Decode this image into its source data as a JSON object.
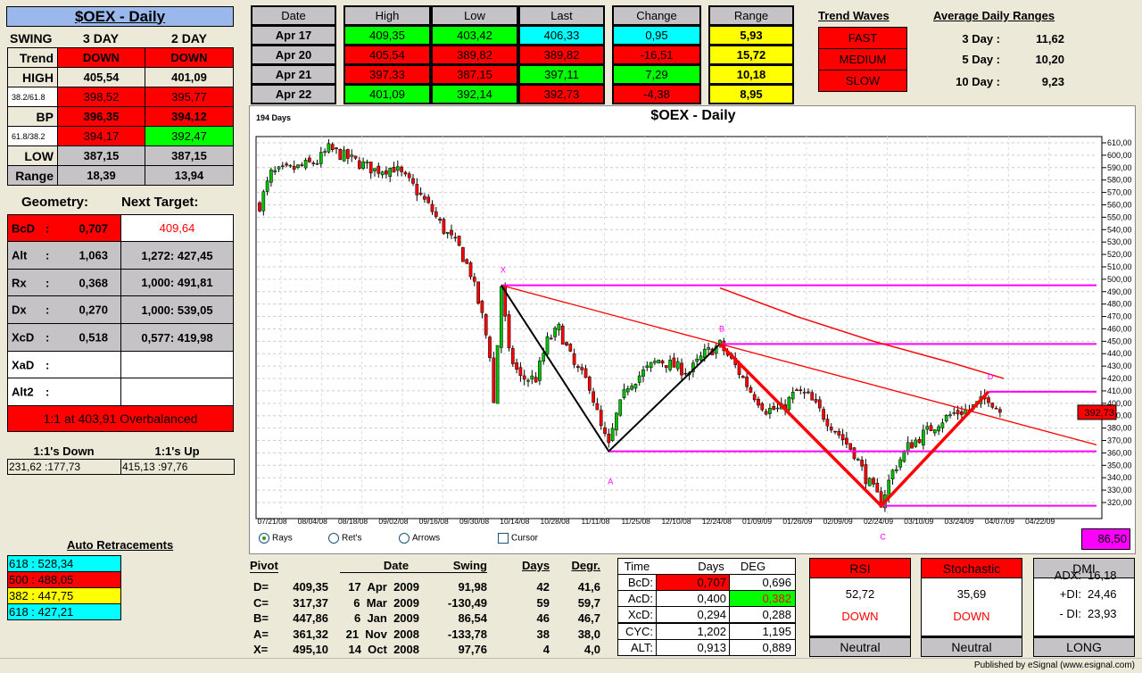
{
  "left": {
    "title": "$OEX - Daily",
    "swing_label": "SWING",
    "col3": "3 DAY",
    "col2": "2 DAY",
    "rows": [
      {
        "label": "Trend",
        "v3": "DOWN",
        "v2": "DOWN"
      },
      {
        "label": "HIGH",
        "v3": "405,54",
        "v2": "401,09"
      },
      {
        "label": "38.2/61.8",
        "v3": "398,52",
        "v2": "395,77"
      },
      {
        "label": "BP",
        "v3": "396,35",
        "v2": "394,12"
      },
      {
        "label": "61.8/38.2",
        "v3": "394,17",
        "v2": "392,47"
      },
      {
        "label": "LOW",
        "v3": "387,15",
        "v2": "387,15"
      },
      {
        "label": "Range",
        "v3": "18,39",
        "v2": "13,94"
      }
    ],
    "geometry_label": "Geometry:",
    "next_target_label": "Next Target:",
    "geometry": [
      {
        "name": "BcD",
        "val": "0,707",
        "target": "409,64"
      },
      {
        "name": "Alt",
        "val": "1,063",
        "target": "1,272: 427,45"
      },
      {
        "name": "Rx",
        "val": "0,368",
        "target": "1,000: 491,81"
      },
      {
        "name": "Dx",
        "val": "0,270",
        "target": "1,000: 539,05"
      },
      {
        "name": "XcD",
        "val": "0,518",
        "target": "0,577: 419,98"
      },
      {
        "name": "XaD",
        "val": "",
        "target": ""
      },
      {
        "name": "Alt2",
        "val": "",
        "target": ""
      }
    ],
    "colon": ":",
    "overbalanced": "1:1 at 403,91 Overbalanced",
    "down_label": "1:1's Down",
    "up_label": "1:1's Up",
    "down_value": "231,62 :177,73",
    "up_value": "415,13 :97,76",
    "auto_ret_label": "Auto Retracements",
    "auto_ret": [
      "618 : 528,34",
      "500 : 488,05",
      "382 : 447,75",
      "618 : 427,21"
    ]
  },
  "top": {
    "headers": {
      "date": "Date",
      "high": "High",
      "low": "Low",
      "last": "Last",
      "change": "Change",
      "range": "Range"
    },
    "rows": [
      {
        "date": "Apr  17",
        "high": "409,35",
        "low": "403,42",
        "last": "406,33",
        "change": "0,95",
        "range": "5,93"
      },
      {
        "date": "Apr  20",
        "high": "405,54",
        "low": "389,82",
        "last": "389,82",
        "change": "-16,51",
        "range": "15,72"
      },
      {
        "date": "Apr  21",
        "high": "397,33",
        "low": "387,15",
        "last": "397,11",
        "change": "7,29",
        "range": "10,18"
      },
      {
        "date": "Apr  22",
        "high": "401,09",
        "low": "392,14",
        "last": "392,73",
        "change": "-4,38",
        "range": "8,95"
      }
    ],
    "trend_waves_label": "Trend Waves",
    "trend_waves": [
      "FAST",
      "MEDIUM",
      "SLOW"
    ],
    "adr_label": "Average Daily Ranges",
    "adr": [
      {
        "label": "3 Day :",
        "val": "11,62"
      },
      {
        "label": "5 Day :",
        "val": "10,20"
      },
      {
        "label": "10 Day :",
        "val": "9,23"
      }
    ]
  },
  "chart": {
    "days_label": "194 Days",
    "title": "$OEX - Daily",
    "last_price": "392,73",
    "magenta_value": "86,50",
    "options": {
      "rays": "Rays",
      "rets": "Ret's",
      "arrows": "Arrows",
      "cursor": "Cursor"
    }
  },
  "chart_data": {
    "type": "candlestick",
    "title": "$OEX - Daily",
    "ylim": [
      320,
      610
    ],
    "y_ticks": [
      "610,00",
      "600,00",
      "590,00",
      "580,00",
      "570,00",
      "560,00",
      "550,00",
      "540,00",
      "530,00",
      "520,00",
      "510,00",
      "500,00",
      "490,00",
      "480,00",
      "470,00",
      "460,00",
      "450,00",
      "440,00",
      "430,00",
      "420,00",
      "410,00",
      "400,00",
      "390,00",
      "380,00",
      "370,00",
      "360,00",
      "350,00",
      "340,00",
      "330,00",
      "320,00"
    ],
    "x_ticks": [
      "07/21/08",
      "08/04/08",
      "08/18/08",
      "09/02/08",
      "09/16/08",
      "09/30/08",
      "10/14/08",
      "10/28/08",
      "11/11/08",
      "11/25/08",
      "12/10/08",
      "12/24/08",
      "01/09/09",
      "01/26/09",
      "02/09/09",
      "02/24/09",
      "03/10/09",
      "03/24/09",
      "04/07/09",
      "04/22/09"
    ],
    "num_bars": 194,
    "close_anchors": [
      [
        0,
        560
      ],
      [
        3,
        585
      ],
      [
        10,
        590
      ],
      [
        15,
        595
      ],
      [
        18,
        605
      ],
      [
        25,
        595
      ],
      [
        30,
        588
      ],
      [
        35,
        590
      ],
      [
        40,
        575
      ],
      [
        45,
        555
      ],
      [
        48,
        540
      ],
      [
        52,
        525
      ],
      [
        55,
        505
      ],
      [
        58,
        470
      ],
      [
        60,
        440
      ],
      [
        61,
        400
      ],
      [
        63,
        495
      ],
      [
        65,
        440
      ],
      [
        68,
        420
      ],
      [
        72,
        420
      ],
      [
        75,
        450
      ],
      [
        78,
        460
      ],
      [
        82,
        430
      ],
      [
        86,
        415
      ],
      [
        89,
        380
      ],
      [
        91,
        365
      ],
      [
        93,
        390
      ],
      [
        96,
        415
      ],
      [
        100,
        425
      ],
      [
        104,
        435
      ],
      [
        108,
        430
      ],
      [
        112,
        425
      ],
      [
        116,
        440
      ],
      [
        120,
        447
      ],
      [
        124,
        430
      ],
      [
        128,
        410
      ],
      [
        132,
        395
      ],
      [
        136,
        395
      ],
      [
        140,
        410
      ],
      [
        143,
        405
      ],
      [
        147,
        390
      ],
      [
        151,
        375
      ],
      [
        155,
        360
      ],
      [
        158,
        340
      ],
      [
        162,
        320
      ],
      [
        165,
        345
      ],
      [
        169,
        365
      ],
      [
        173,
        375
      ],
      [
        177,
        385
      ],
      [
        181,
        392
      ],
      [
        185,
        395
      ],
      [
        190,
        405
      ],
      [
        193,
        392.73
      ]
    ],
    "pivots": [
      {
        "label": "X",
        "bar": 63,
        "price": 495.1
      },
      {
        "label": "A",
        "bar": 91,
        "price": 361.32
      },
      {
        "label": "B",
        "bar": 120,
        "price": 447.86
      },
      {
        "label": "C",
        "bar": 162,
        "price": 317.37
      },
      {
        "label": "D",
        "bar": 190,
        "price": 409.35
      }
    ],
    "moving_average": [
      [
        120,
        493
      ],
      [
        140,
        470
      ],
      [
        160,
        450
      ],
      [
        180,
        433
      ],
      [
        194,
        420
      ]
    ],
    "colors": {
      "up": "#00c000",
      "down": "#ff0000",
      "pivot_lines": "#ff00ff",
      "trend": "#ff0000"
    }
  },
  "pivot_table": {
    "headers": [
      "Pivot",
      "Date",
      "Swing",
      "Days",
      "Degr."
    ],
    "rows": [
      {
        "p": "D=",
        "v": "409,35",
        "d": "17  Apr  2009",
        "s": "91,98",
        "days": "42",
        "deg": "41,6"
      },
      {
        "p": "C=",
        "v": "317,37",
        "d": "6  Mar  2009",
        "s": "-130,49",
        "days": "59",
        "deg": "59,7"
      },
      {
        "p": "B=",
        "v": "447,86",
        "d": "6  Jan  2009",
        "s": "86,54",
        "days": "46",
        "deg": "46,7"
      },
      {
        "p": "A=",
        "v": "361,32",
        "d": "21  Nov  2008",
        "s": "-133,78",
        "days": "38",
        "deg": "38,0"
      },
      {
        "p": "X=",
        "v": "495,10",
        "d": "14  Oct  2008",
        "s": "97,76",
        "days": "4",
        "deg": "4,0"
      }
    ]
  },
  "time_table": {
    "headers": [
      "Time",
      "Days",
      "DEG"
    ],
    "rows": [
      {
        "k": "BcD:",
        "days": "0,707",
        "deg": "0,696"
      },
      {
        "k": "AcD:",
        "days": "0,400",
        "deg": "0,382"
      },
      {
        "k": "XcD:",
        "days": "0,294",
        "deg": "0,288"
      },
      {
        "k": "CYC:",
        "days": "1,202",
        "deg": "1,195"
      },
      {
        "k": "ALT:",
        "days": "0,913",
        "deg": "0,889"
      }
    ]
  },
  "indicators": {
    "rsi": {
      "title": "RSI",
      "value": "52,72",
      "dir": "DOWN",
      "status": "Neutral"
    },
    "stoch": {
      "title": "Stochastic",
      "value": "35,69",
      "dir": "DOWN",
      "status": "Neutral"
    },
    "dmi": {
      "title": "DMI",
      "adx_label": "ADX:",
      "adx": "16,18",
      "pdi_label": "+DI:",
      "pdi": "24,46",
      "mdi_label": "- DI:",
      "mdi": "23,93",
      "status": "LONG"
    }
  },
  "status_bar": {
    "text": "Published by eSignal (www.esignal.com)"
  }
}
